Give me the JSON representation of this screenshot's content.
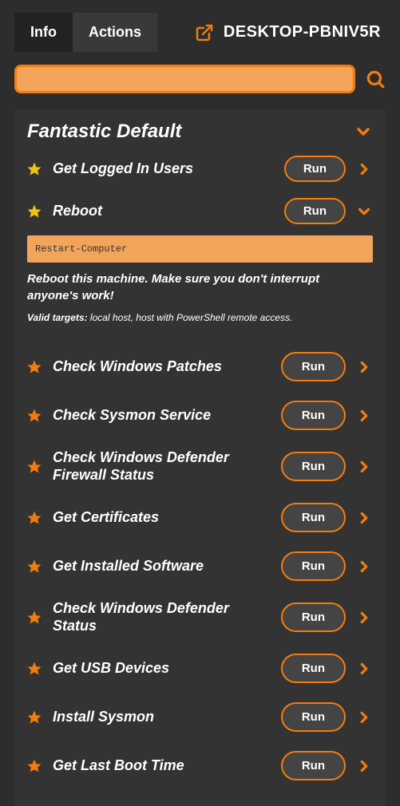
{
  "tabs": {
    "info": "Info",
    "actions": "Actions"
  },
  "hostname": "DESKTOP-PBNIV5R",
  "search": {
    "value": "",
    "placeholder": ""
  },
  "section_title": "Fantastic Default",
  "run_label": "Run",
  "top_items": [
    {
      "label": "Get Logged In Users",
      "star": "yellow",
      "expanded": false
    },
    {
      "label": "Reboot",
      "star": "yellow",
      "expanded": true
    }
  ],
  "expanded_detail": {
    "command": "Restart-Computer",
    "description": "Reboot this machine. Make sure you don't interrupt anyone's work!",
    "valid_targets_label": "Valid targets:",
    "valid_targets_value": " local host, host with PowerShell remote access."
  },
  "bottom_items": [
    {
      "label": "Check Windows Patches"
    },
    {
      "label": "Check Sysmon Service"
    },
    {
      "label": "Check Windows Defender Firewall Status"
    },
    {
      "label": "Get Certificates"
    },
    {
      "label": "Get Installed Software"
    },
    {
      "label": "Check Windows Defender Status"
    },
    {
      "label": "Get USB Devices"
    },
    {
      "label": "Install Sysmon"
    },
    {
      "label": "Get Last Boot Time"
    }
  ]
}
